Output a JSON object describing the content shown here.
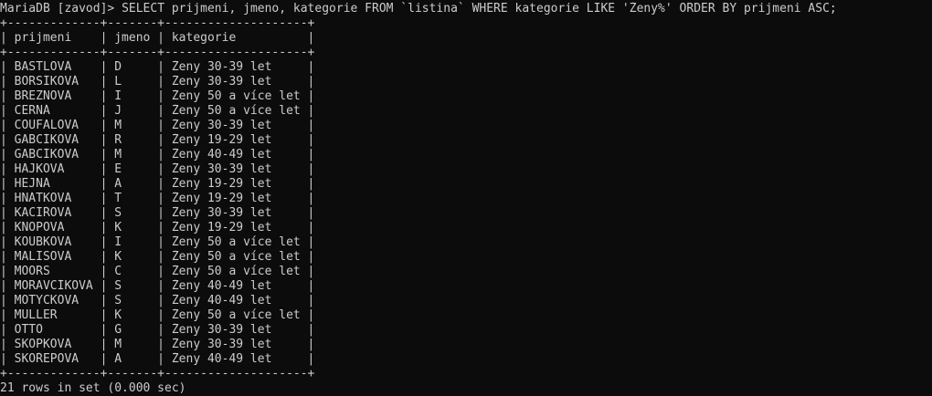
{
  "prompt": "MariaDB [zavod]> ",
  "query": "SELECT prijmeni, jmeno, kategorie FROM `listina` WHERE kategorie LIKE 'Ženy%' ORDER BY prijmeni ASC;",
  "table": {
    "border_top": "+-------------+-------+--------------------+",
    "header": "| prijmeni    | jmeno | kategorie          |",
    "border_mid": "+-------------+-------+--------------------+",
    "rows": [
      "| BASTLOVÁ    | D     | Ženy 30-39 let     |",
      "| BORSÍKOVÁ   | L     | Ženy 30-39 let     |",
      "| BŘEZNOVÁ    | I     | Ženy 50 a více let |",
      "| ČERNÁ       | J     | Ženy 50 a více let |",
      "| COUFALOVÁ   | M     | Ženy 30-39 let     |",
      "| GABČÍKOVÁ   | R     | Ženy 19-29 let     |",
      "| GABČÍKOVÁ   | M     | Ženy 40-49 let     |",
      "| HÁJKOVÁ     | E     | Ženy 30-39 let     |",
      "| HEJNÁ       | A     | Ženy 19-29 let     |",
      "| HNÁTKOVÁ    | T     | Ženy 19-29 let     |",
      "| KACÍŘOVÁ    | S     | Ženy 30-39 let     |",
      "| KNOPOVÁ     | K     | Ženy 19-29 let     |",
      "| KOUBKOVÁ    | I     | Ženy 50 a více let |",
      "| MALIŠOVÁ    | K     | Ženy 50 a více let |",
      "| MOORS       | C     | Ženy 50 a více let |",
      "| MORAVČÍKOVÁ | S     | Ženy 40-49 let     |",
      "| MOTYCKOVA   | S     | Ženy 40-49 let     |",
      "| MÜLLER      | K     | Ženy 50 a více let |",
      "| OTTO        | G     | Ženy 30-39 let     |",
      "| ŠKOPKOVÁ    | M     | Ženy 30-39 let     |",
      "| SKOŘEPOVÁ   | A     | Ženy 40-49 let     |"
    ],
    "border_bottom": "+-------------+-------+--------------------+"
  },
  "result_summary": "21 rows in set (0.000 sec)",
  "colors": {
    "background": "#0c0c0c",
    "text": "#cccccc"
  }
}
